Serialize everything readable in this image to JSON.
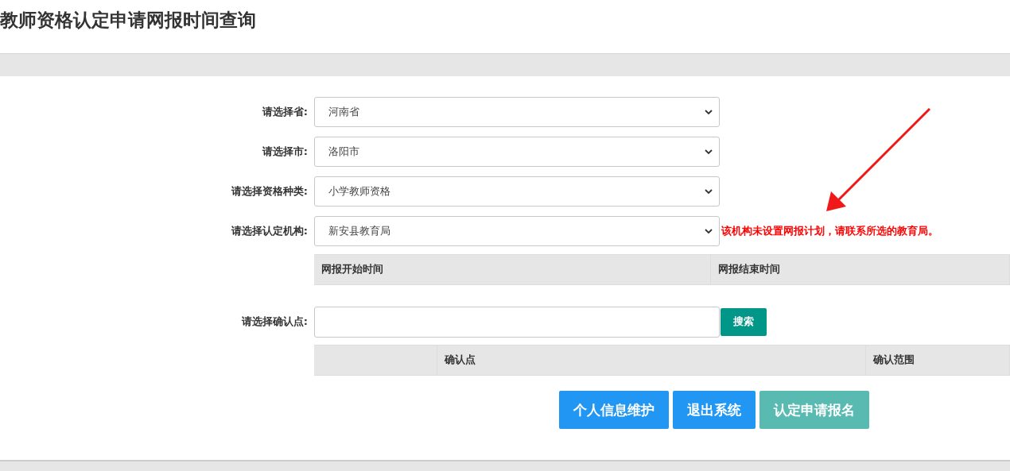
{
  "page_title": "教师资格认定申请网报时间查询",
  "form": [
    {
      "label": "请选择省:",
      "value": "河南省"
    },
    {
      "label": "请选择市:",
      "value": "洛阳市"
    },
    {
      "label": "请选择资格种类:",
      "value": "小学教师资格"
    },
    {
      "label": "请选择认定机构:",
      "value": "新安县教育局",
      "message": "该机构未设置网报计划，请联系所选的教育局。"
    }
  ],
  "schedule_table": {
    "columns": [
      "网报开始时间",
      "网报结束时间"
    ]
  },
  "confirm_point": {
    "label": "请选择确认点:",
    "search_button": "搜索"
  },
  "confirm_table": {
    "columns": [
      "",
      "确认点",
      "确认范围"
    ]
  },
  "buttons": [
    {
      "label": "个人信息维护",
      "kind": "primary",
      "disabled": false
    },
    {
      "label": "退出系统",
      "kind": "primary",
      "disabled": false
    },
    {
      "label": "认定申请报名",
      "kind": "success",
      "disabled": true
    }
  ]
}
